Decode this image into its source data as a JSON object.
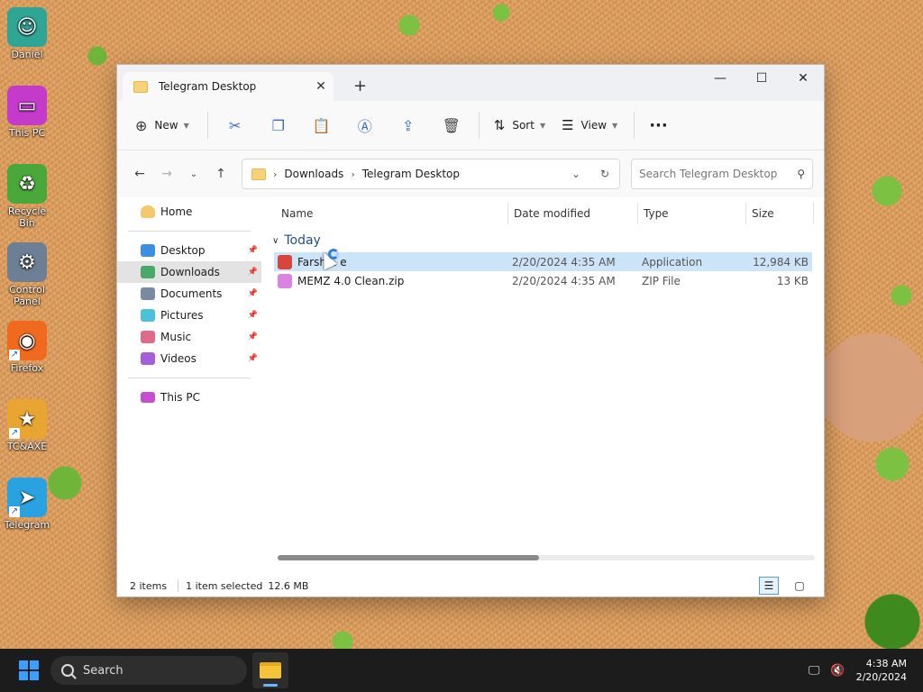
{
  "desktop": {
    "icons": [
      {
        "label": "Daniel",
        "glyph": "☺",
        "color": "#2fa596"
      },
      {
        "label": "This PC",
        "glyph": "▭",
        "color": "#c43acb"
      },
      {
        "label": "Recycle Bin",
        "glyph": "♻",
        "color": "#4aa83a"
      },
      {
        "label": "Control Panel",
        "glyph": "⚙",
        "color": "#6d7f95"
      },
      {
        "label": "Firefox",
        "glyph": "◉",
        "color": "#ef6a1f"
      },
      {
        "label": "TC&AXE",
        "glyph": "★",
        "color": "#e8a531"
      },
      {
        "label": "Telegram",
        "glyph": "➤",
        "color": "#2aa2e0"
      }
    ]
  },
  "window": {
    "tab_title": "Telegram Desktop",
    "tab_close": "✕",
    "new_tab": "+",
    "controls": {
      "minimize": "—",
      "maximize": "☐",
      "close": "✕"
    }
  },
  "toolbar": {
    "new_label": "New",
    "sort_label": "Sort",
    "view_label": "View",
    "more": "···"
  },
  "address": {
    "crumbs": [
      "Downloads",
      "Telegram Desktop"
    ],
    "search_placeholder": "Search Telegram Desktop"
  },
  "sidebar": {
    "home": "Home",
    "pinned": [
      {
        "label": "Desktop",
        "color": "#3b8ee0"
      },
      {
        "label": "Downloads",
        "color": "#4aa86a"
      },
      {
        "label": "Documents",
        "color": "#7a8aa0"
      },
      {
        "label": "Pictures",
        "color": "#4ec0d8"
      },
      {
        "label": "Music",
        "color": "#e06a8a"
      },
      {
        "label": "Videos",
        "color": "#a560d8"
      }
    ],
    "this_pc": "This PC"
  },
  "columns": {
    "name": "Name",
    "date": "Date modified",
    "type": "Type",
    "size": "Size"
  },
  "group": "Today",
  "files": [
    {
      "name": "Farsh... e",
      "date": "2/20/2024 4:35 AM",
      "type": "Application",
      "size": "12,984 KB",
      "icon_color": "#d8453c",
      "selected": true
    },
    {
      "name": "MEMZ 4.0 Clean.zip",
      "date": "2/20/2024 4:35 AM",
      "type": "ZIP File",
      "size": "13 KB",
      "icon_color": "#d984e0",
      "selected": false
    }
  ],
  "status": {
    "count": "2 items",
    "selection": "1 item selected",
    "size": "12.6 MB"
  },
  "taskbar": {
    "search_label": "Search",
    "time": "4:38 AM",
    "date": "2/20/2024"
  }
}
